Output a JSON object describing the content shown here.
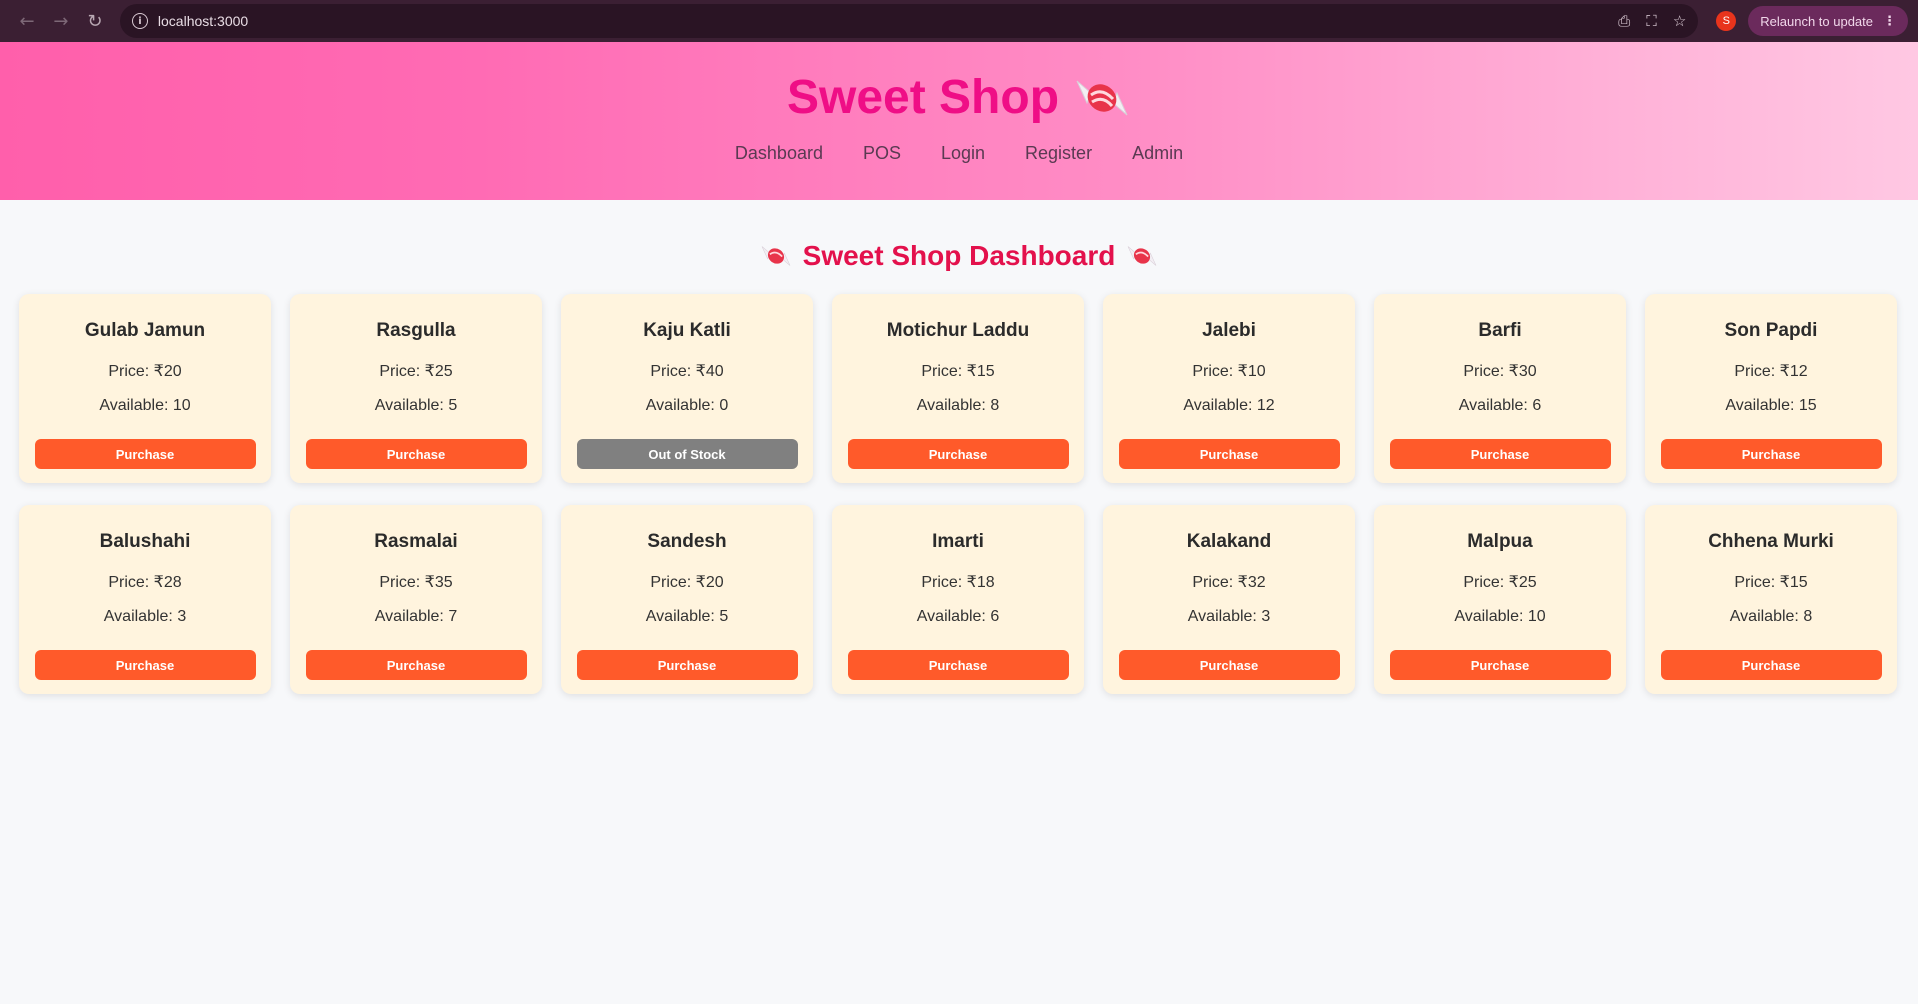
{
  "browser": {
    "url": "localhost:3000",
    "profile_initial": "S",
    "relaunch_label": "Relaunch to update"
  },
  "header": {
    "title": "Sweet Shop",
    "nav": [
      "Dashboard",
      "POS",
      "Login",
      "Register",
      "Admin"
    ]
  },
  "dashboard": {
    "title": "Sweet Shop Dashboard"
  },
  "colors": {
    "title": "#ef0e86",
    "dashboard_title": "#e3114c",
    "purchase_button": "#ff5a2a",
    "out_of_stock_button": "#808080",
    "card_background": "#fff4de"
  },
  "sweets": [
    {
      "name": "Gulab Jamun",
      "price": "Price: ₹20",
      "available": "Available: 10",
      "button": "Purchase",
      "in_stock": true
    },
    {
      "name": "Rasgulla",
      "price": "Price: ₹25",
      "available": "Available: 5",
      "button": "Purchase",
      "in_stock": true
    },
    {
      "name": "Kaju Katli",
      "price": "Price: ₹40",
      "available": "Available: 0",
      "button": "Out of Stock",
      "in_stock": false
    },
    {
      "name": "Motichur Laddu",
      "price": "Price: ₹15",
      "available": "Available: 8",
      "button": "Purchase",
      "in_stock": true
    },
    {
      "name": "Jalebi",
      "price": "Price: ₹10",
      "available": "Available: 12",
      "button": "Purchase",
      "in_stock": true
    },
    {
      "name": "Barfi",
      "price": "Price: ₹30",
      "available": "Available: 6",
      "button": "Purchase",
      "in_stock": true
    },
    {
      "name": "Son Papdi",
      "price": "Price: ₹12",
      "available": "Available: 15",
      "button": "Purchase",
      "in_stock": true
    },
    {
      "name": "Balushahi",
      "price": "Price: ₹28",
      "available": "Available: 3",
      "button": "Purchase",
      "in_stock": true
    },
    {
      "name": "Rasmalai",
      "price": "Price: ₹35",
      "available": "Available: 7",
      "button": "Purchase",
      "in_stock": true
    },
    {
      "name": "Sandesh",
      "price": "Price: ₹20",
      "available": "Available: 5",
      "button": "Purchase",
      "in_stock": true
    },
    {
      "name": "Imarti",
      "price": "Price: ₹18",
      "available": "Available: 6",
      "button": "Purchase",
      "in_stock": true
    },
    {
      "name": "Kalakand",
      "price": "Price: ₹32",
      "available": "Available: 3",
      "button": "Purchase",
      "in_stock": true
    },
    {
      "name": "Malpua",
      "price": "Price: ₹25",
      "available": "Available: 10",
      "button": "Purchase",
      "in_stock": true
    },
    {
      "name": "Chhena Murki",
      "price": "Price: ₹15",
      "available": "Available: 8",
      "button": "Purchase",
      "in_stock": true
    }
  ]
}
